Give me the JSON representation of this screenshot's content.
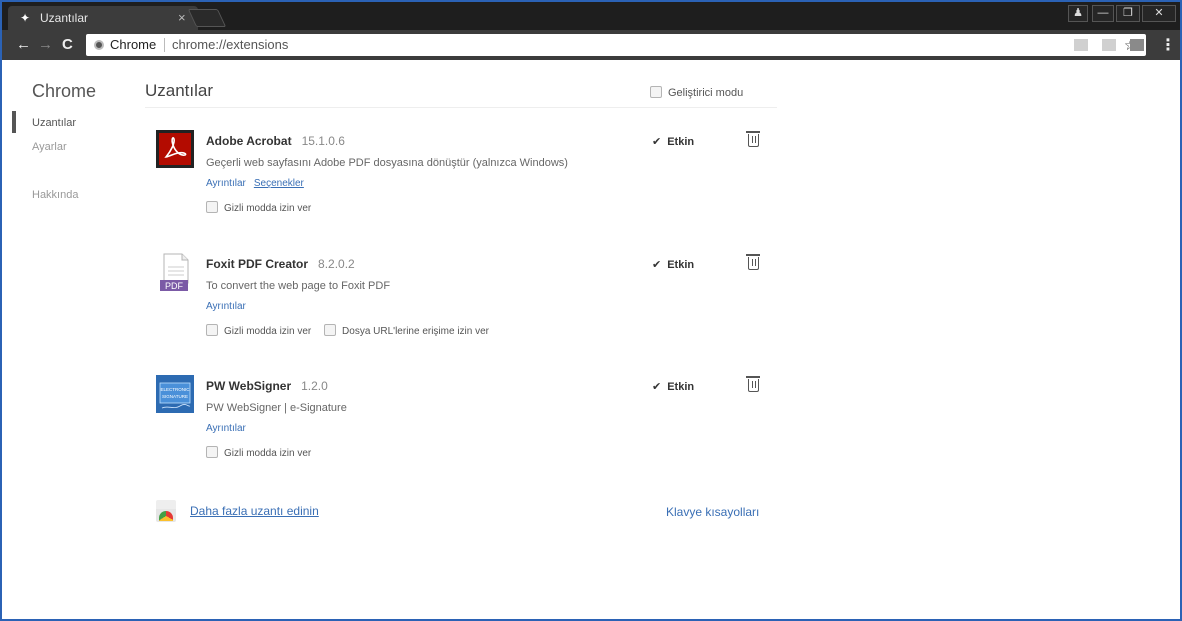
{
  "tab": {
    "title": "Uzantılar",
    "favicon": "puzzle-icon"
  },
  "omnibox": {
    "origin": "Chrome",
    "url": "chrome://extensions"
  },
  "sidebar": {
    "title": "Chrome",
    "items": [
      {
        "label": "Uzantılar",
        "active": true
      },
      {
        "label": "Ayarlar",
        "active": false
      },
      {
        "label": "Hakkında",
        "active": false
      }
    ]
  },
  "header": {
    "title": "Uzantılar",
    "dev_mode": "Geliştirici modu"
  },
  "extensions": [
    {
      "name": "Adobe Acrobat",
      "version": "15.1.0.6",
      "description": "Geçerli web sayfasını Adobe PDF dosyasına dönüştür (yalnızca Windows)",
      "details_label": "Ayrıntılar",
      "options_label": "Seçenekler",
      "incognito_label": "Gizli modda izin ver",
      "enabled_label": "Etkin",
      "enabled": true
    },
    {
      "name": "Foxit PDF Creator",
      "version": "8.2.0.2",
      "description": "To convert the web page to Foxit PDF",
      "details_label": "Ayrıntılar",
      "incognito_label": "Gizli modda izin ver",
      "file_urls_label": "Dosya URL'lerine erişime izin ver",
      "enabled_label": "Etkin",
      "enabled": true
    },
    {
      "name": "PW WebSigner",
      "version": "1.2.0",
      "description": "PW WebSigner | e-Signature",
      "details_label": "Ayrıntılar",
      "incognito_label": "Gizli modda izin ver",
      "enabled_label": "Etkin",
      "enabled": true
    }
  ],
  "footer": {
    "more_extensions": "Daha fazla uzantı edinin",
    "keyboard_shortcuts": "Klavye kısayolları"
  },
  "icons": {
    "foxit_badge": "PDF",
    "pw_logo_line1": "ELECTRONIC",
    "pw_logo_line2": "SIGNATURE"
  },
  "colors": {
    "accent_link": "#3a6fb5",
    "window_border": "#2b62b5",
    "acrobat_red": "#b30b00"
  }
}
